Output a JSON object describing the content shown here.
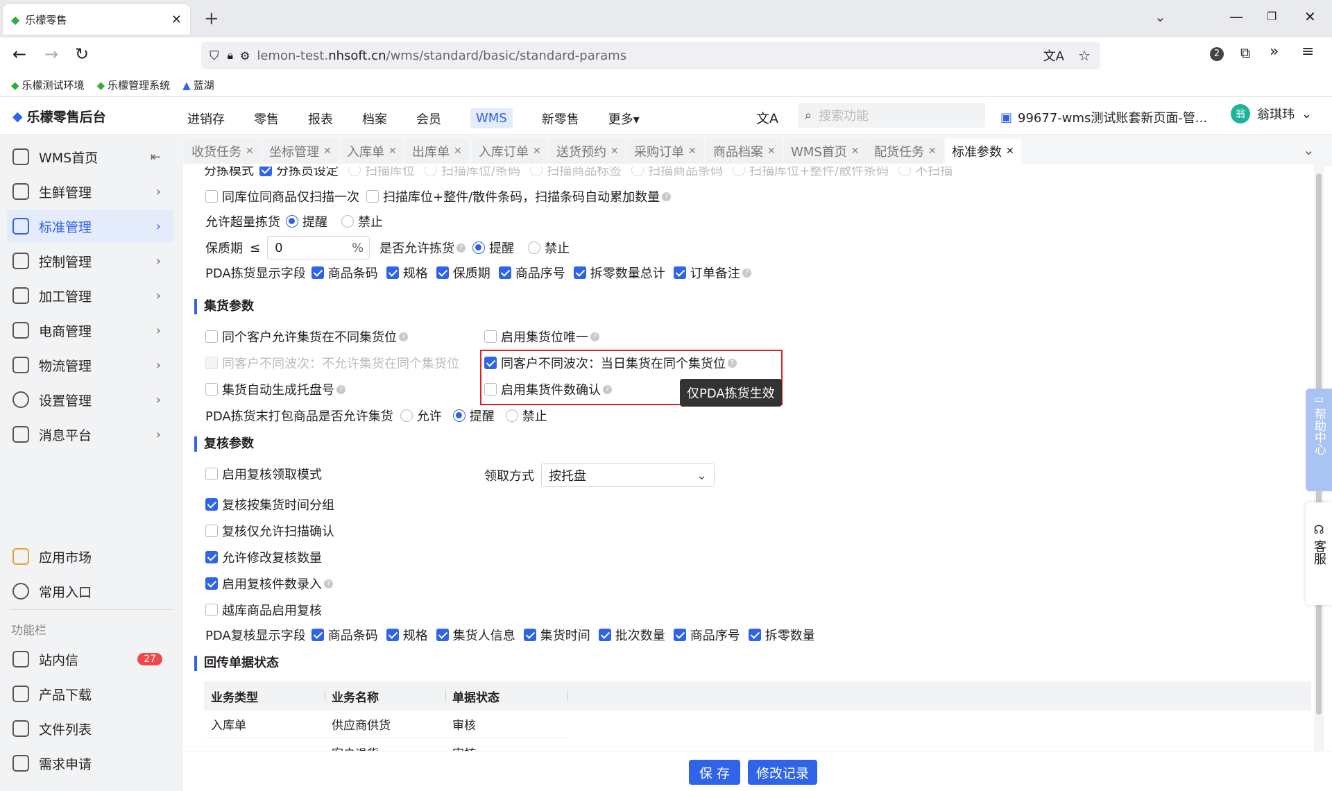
{
  "browser": {
    "tab_title": "乐檬零售",
    "new_tab": "+",
    "url_host": "lemon-test.",
    "url_domain": "nhsoft.cn",
    "url_path": "/wms/standard/basic/standard-params",
    "ext_badge": "2"
  },
  "bookmarks": [
    "乐檬测试环境",
    "乐檬管理系统",
    "蓝湖"
  ],
  "app": {
    "logo": "乐檬零售后台",
    "topnav": [
      "进销存",
      "零售",
      "报表",
      "档案",
      "会员",
      "WMS",
      "新零售",
      "更多▾"
    ],
    "search_placeholder": "搜索功能",
    "account": "99677-wms测试账套新页面-管...",
    "user": "翁琪玮",
    "avatar": "翁"
  },
  "sidebar": {
    "items": [
      "WMS首页",
      "生鲜管理",
      "标准管理",
      "控制管理",
      "加工管理",
      "电商管理",
      "物流管理",
      "设置管理",
      "消息平台"
    ],
    "bottom": [
      "应用市场",
      "常用入口"
    ],
    "section": "功能栏",
    "tools": [
      "站内信",
      "产品下载",
      "文件列表",
      "需求申请"
    ],
    "badge": "27"
  },
  "tabs": [
    "收货任务",
    "坐标管理",
    "入库单",
    "出库单",
    "入库订单",
    "送货预约",
    "采购订单",
    "商品档案",
    "WMS首页",
    "配货任务",
    "标准参数"
  ],
  "content": {
    "r0_label": "分拣模式",
    "r0_opts": [
      "分拣员设定",
      "扫描库位",
      "扫描库位/条码",
      "扫描商品标签",
      "扫描商品条码",
      "扫描库位+整件/散件条码",
      "不扫描"
    ],
    "r1a": "同库位同商品仅扫描一次",
    "r1b": "扫描库位+整件/散件条码，扫描条码自动累加数量",
    "r2_label": "允许超量拣货",
    "r2_o1": "提醒",
    "r2_o2": "禁止",
    "r3_label": "保质期",
    "r3_le": "≤",
    "r3_val": "0",
    "r3_unit": "%",
    "r3_label2": "是否允许拣货",
    "r3_o1": "提醒",
    "r3_o2": "禁止",
    "r4_label": "PDA拣货显示字段",
    "r4_fields": [
      "商品条码",
      "规格",
      "保质期",
      "商品序号",
      "拆零数量总计",
      "订单备注"
    ],
    "sec1": "集货参数",
    "c1": "同个客户允许集货在不同集货位",
    "c2": "启用集货位唯一",
    "c3": "同客户不同波次：不允许集货在同个集货位",
    "c4": "同客户不同波次：当日集货在同个集货位",
    "c5": "集货自动生成托盘号",
    "c6": "启用集货件数确认",
    "tooltip": "仅PDA拣货生效",
    "c7_label": "PDA拣货末打包商品是否允许集货",
    "c7_opts": [
      "允许",
      "提醒",
      "禁止"
    ],
    "sec2": "复核参数",
    "d1": "启用复核领取模式",
    "d_mode_label": "领取方式",
    "d_mode_val": "按托盘",
    "d2": "复核按集货时间分组",
    "d3": "复核仅允许扫描确认",
    "d4": "允许修改复核数量",
    "d5": "启用复核件数录入",
    "d6": "越库商品启用复核",
    "d7_label": "PDA复核显示字段",
    "d7_fields": [
      "商品条码",
      "规格",
      "集货人信息",
      "集货时间",
      "批次数量",
      "商品序号",
      "拆零数量"
    ],
    "sec3": "回传单据状态",
    "table": {
      "headers": [
        "业务类型",
        "业务名称",
        "单据状态"
      ],
      "rows": [
        [
          "入库单",
          "供应商供货",
          "审核"
        ],
        [
          "",
          "客户退货",
          "审核"
        ]
      ]
    },
    "save": "保 存",
    "log": "修改记录"
  },
  "float": {
    "help": "帮助中心",
    "service": "客服"
  }
}
